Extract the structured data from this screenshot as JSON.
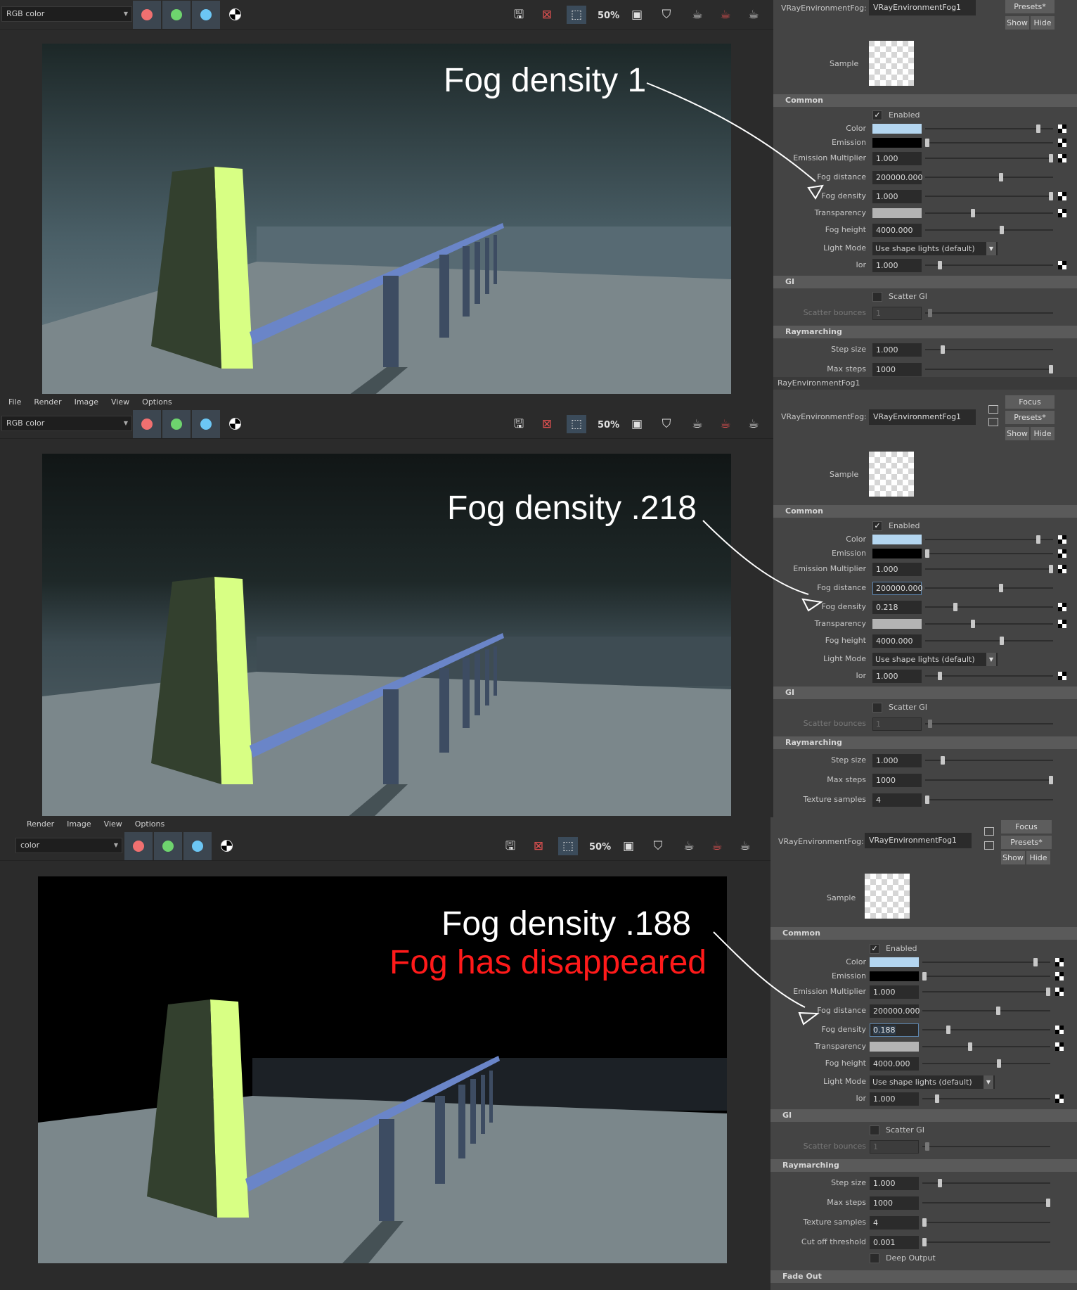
{
  "menu": [
    "File",
    "Render",
    "Image",
    "View",
    "Options"
  ],
  "channel": "RGB color",
  "channel_short": "color",
  "zoom": "50%",
  "callouts": {
    "p1": "Fog density 1",
    "p2": "Fog density .218",
    "p3": "Fog density  .188",
    "p3b": "Fog has disappeared"
  },
  "ae": {
    "node_type": "VRayEnvironmentFog:",
    "node_name": "VRayEnvironmentFog1",
    "tab_label": "RayEnvironmentFog1",
    "focus": "Focus",
    "presets": "Presets*",
    "show": "Show",
    "hide": "Hide",
    "sample": "Sample",
    "sections": {
      "common": "Common",
      "gi": "GI",
      "ray": "Raymarching",
      "fade": "Fade Out"
    },
    "labels": {
      "enabled": "Enabled",
      "color": "Color",
      "emission": "Emission",
      "em_mult": "Emission Multiplier",
      "fog_distance": "Fog distance",
      "fog_density": "Fog density",
      "transparency": "Transparency",
      "fog_height": "Fog height",
      "light_mode": "Light Mode",
      "ior": "Ior",
      "scatter_gi": "Scatter GI",
      "scatter_bounces": "Scatter bounces",
      "step_size": "Step size",
      "max_steps": "Max steps",
      "texture_samples": "Texture samples",
      "cutoff": "Cut off threshold",
      "deep_output": "Deep Output"
    },
    "values": {
      "em_mult": "1.000",
      "fog_distance": "200000.000",
      "fog_height": "4000.000",
      "light_mode": "Use shape lights (default)",
      "ior": "1.000",
      "scatter_bounces": "1",
      "step_size": "1.000",
      "max_steps": "1000",
      "texture_samples": "4",
      "cutoff": "0.001"
    },
    "density": {
      "p1": "1.000",
      "p2": "0.218",
      "p3": "0.188"
    },
    "colors": {
      "fog": "#b4d6f0",
      "emission": "#000000",
      "transparency": "#b4b4b4"
    }
  }
}
